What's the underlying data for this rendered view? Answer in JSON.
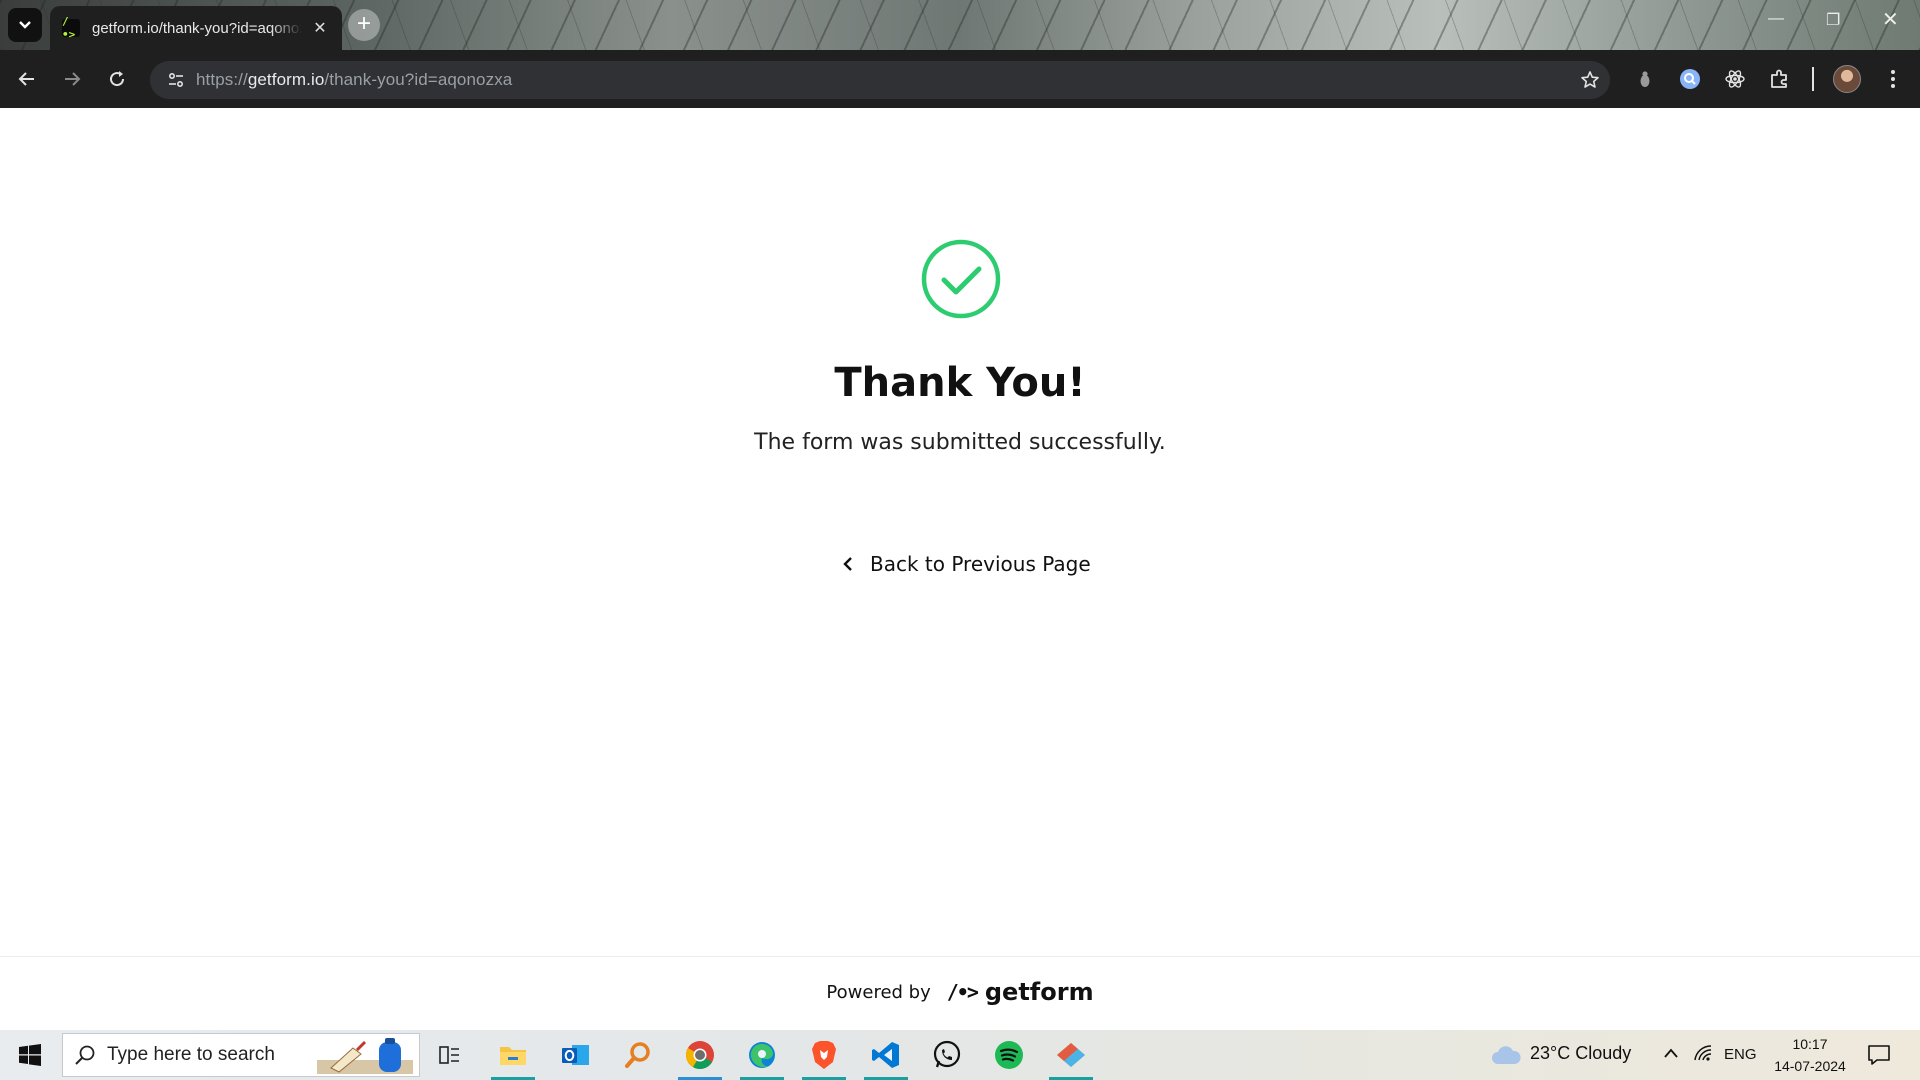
{
  "browser": {
    "tab_title": "getform.io/thank-you?id=aqonozxa",
    "tab_favicon_text": "/•>",
    "url_prefix": "https://",
    "url_host": "getform.io",
    "url_path": "/thank-you?id=aqonozxa"
  },
  "page": {
    "title": "Thank You!",
    "subtitle": "The form was submitted successfully.",
    "back_link": "Back to Previous Page",
    "powered_by": "Powered by",
    "brand_mark": "/•>",
    "brand_name": "getform",
    "accent_color": "#2ecc71"
  },
  "taskbar": {
    "search_placeholder": "Type here to search",
    "weather": "23°C  Cloudy",
    "language": "ENG",
    "time": "10:17",
    "date": "14-07-2024",
    "apps": [
      "task-view",
      "file-explorer",
      "outlook",
      "search-app",
      "chrome",
      "edge",
      "brave",
      "vscode",
      "whatsapp",
      "spotify",
      "git"
    ]
  }
}
